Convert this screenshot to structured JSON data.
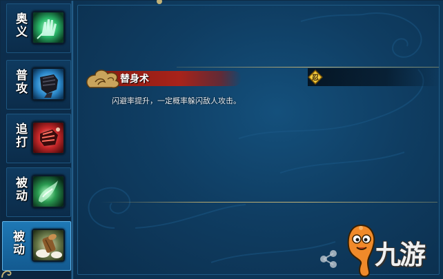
{
  "sidebar": {
    "tabs": [
      {
        "label": "奥义",
        "icon": "palm-strike-icon",
        "active": false
      },
      {
        "label": "普攻",
        "icon": "fist-icon",
        "active": false
      },
      {
        "label": "追打",
        "icon": "red-fist-icon",
        "active": false
      },
      {
        "label": "被动",
        "icon": "green-swirl-icon",
        "active": false
      },
      {
        "label": "被动",
        "icon": "log-substitution-icon",
        "active": true
      }
    ]
  },
  "skill": {
    "name": "替身术",
    "badge": "忍",
    "description": "闪避率提升，一定概率躲闪敌人攻击。"
  },
  "watermark": {
    "text": "九游"
  },
  "colors": {
    "panel": "#0f3d62",
    "tab_active": "#1e78b5",
    "banner_red": "#a8231a",
    "gold": "#c2b277"
  }
}
